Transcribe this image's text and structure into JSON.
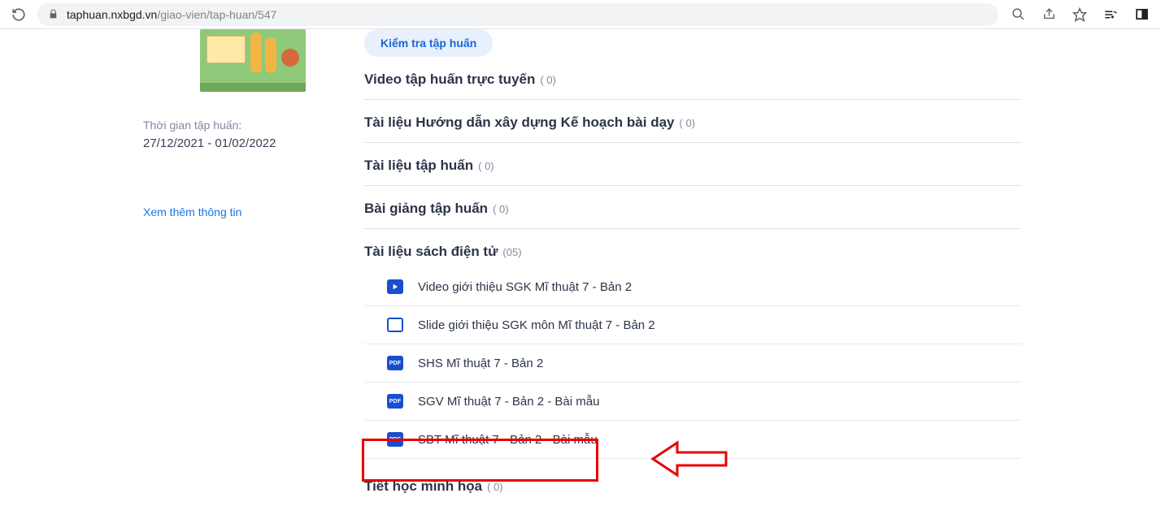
{
  "browser": {
    "url_host": "taphuan.nxbgd.vn",
    "url_path": "/giao-vien/tap-huan/547"
  },
  "sidebar": {
    "time_label": "Thời gian tập huấn:",
    "time_range": "27/12/2021 - 01/02/2022",
    "more_link": "Xem thêm thông tin"
  },
  "main": {
    "test_button": "Kiểm tra tập huấn",
    "sections": [
      {
        "title": "Video tập huấn trực tuyến",
        "count": "( 0)"
      },
      {
        "title": "Tài liệu Hướng dẫn xây dựng Kế hoạch bài dạy",
        "count": "( 0)"
      },
      {
        "title": "Tài liệu tập huấn",
        "count": "( 0)"
      },
      {
        "title": "Bài giảng tập huấn",
        "count": "( 0)"
      }
    ],
    "docs_section": {
      "title": "Tài liệu sách điện tử",
      "count": "(05)"
    },
    "docs": [
      {
        "icon": "video",
        "label": "Video giới thiệu SGK Mĩ thuật 7 - Bản 2"
      },
      {
        "icon": "slide",
        "label": "Slide giới thiệu SGK môn Mĩ thuật 7 - Bản 2"
      },
      {
        "icon": "pdf",
        "label": "SHS Mĩ thuật 7 - Bản 2"
      },
      {
        "icon": "pdf",
        "label": "SGV Mĩ thuật 7 - Bản 2 - Bài mẫu"
      },
      {
        "icon": "pdf",
        "label": "SBT Mĩ thuật 7 - Bản 2 - Bài mẫu"
      }
    ],
    "last_section": {
      "title": "Tiết học minh họa",
      "count": "( 0)"
    }
  }
}
